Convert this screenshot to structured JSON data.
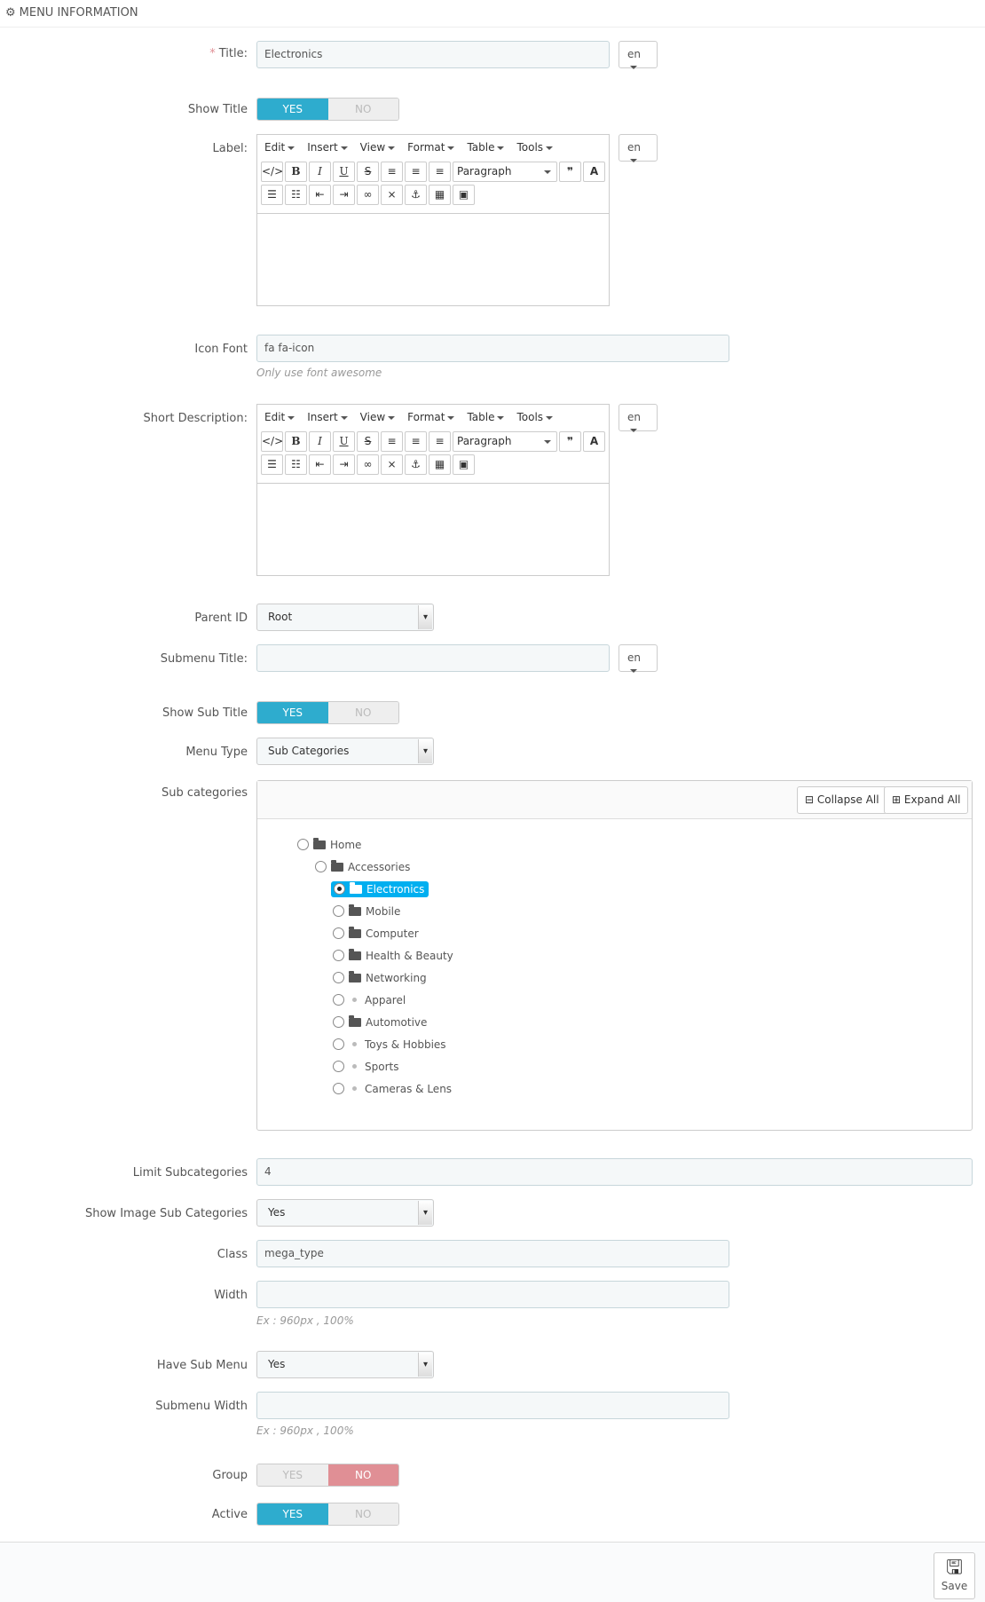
{
  "header": {
    "title": "MENU INFORMATION"
  },
  "title_field": {
    "label": "Title:",
    "value": "Electronics",
    "lang": "en"
  },
  "show_title": {
    "label": "Show Title",
    "yes": "YES",
    "no": "NO"
  },
  "label_field": {
    "label": "Label:",
    "lang": "en",
    "menu": [
      "Edit",
      "Insert",
      "View",
      "Format",
      "Table",
      "Tools"
    ],
    "paragraph": "Paragraph"
  },
  "icon_font": {
    "label": "Icon Font",
    "value": "fa fa-icon",
    "hint": "Only use font awesome"
  },
  "short_description": {
    "label": "Short Description:",
    "lang": "en",
    "menu": [
      "Edit",
      "Insert",
      "View",
      "Format",
      "Table",
      "Tools"
    ],
    "paragraph": "Paragraph"
  },
  "parent_id": {
    "label": "Parent ID",
    "value": "Root"
  },
  "submenu_title": {
    "label": "Submenu Title:",
    "value": "",
    "lang": "en"
  },
  "show_sub_title": {
    "label": "Show Sub Title",
    "yes": "YES",
    "no": "NO"
  },
  "menu_type": {
    "label": "Menu Type",
    "value": "Sub Categories"
  },
  "sub_categories": {
    "label": "Sub categories",
    "collapse": "Collapse All",
    "expand": "Expand All",
    "tree": [
      "Home",
      "Accessories",
      "Electronics",
      "Mobile",
      "Computer",
      "Health & Beauty",
      "Networking",
      "Apparel",
      "Automotive",
      "Toys & Hobbies",
      "Sports",
      "Cameras & Lens"
    ]
  },
  "limit_subcategories": {
    "label": "Limit Subcategories",
    "value": "4"
  },
  "show_image_sub": {
    "label": "Show Image Sub Categories",
    "value": "Yes"
  },
  "class_field": {
    "label": "Class",
    "value": "mega_type"
  },
  "width_field": {
    "label": "Width",
    "value": "",
    "hint": "Ex : 960px , 100%"
  },
  "have_sub_menu": {
    "label": "Have Sub Menu",
    "value": "Yes"
  },
  "submenu_width": {
    "label": "Submenu Width",
    "value": "",
    "hint": "Ex : 960px , 100%"
  },
  "group": {
    "label": "Group",
    "yes": "YES",
    "no": "NO"
  },
  "active": {
    "label": "Active",
    "yes": "YES",
    "no": "NO"
  },
  "footer": {
    "save": "Save"
  }
}
